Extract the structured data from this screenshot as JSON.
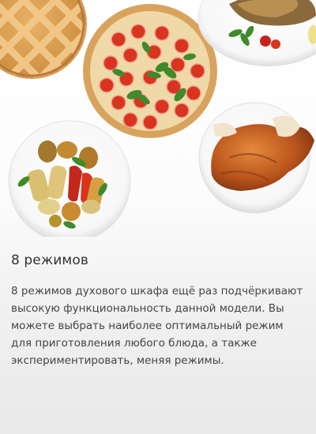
{
  "feature": {
    "title": "8 режимов",
    "description": "8 режимов духового шкафа ещё раз подчёркивают высокую функциональность данной модели. Вы можете выбрать наиболее оптимальный режим для приготовления любого блюда, а также экспериментировать, меняя режимы."
  },
  "illustration": {
    "dishes": [
      "lattice-pie",
      "tomato-pizza",
      "grilled-fish",
      "grilled-vegetables",
      "roasted-duck"
    ]
  },
  "colors": {
    "title": "#333333",
    "text": "#444444",
    "tomato": "#d9341f",
    "basil": "#3f8a2a",
    "crust": "#e0a85a"
  }
}
